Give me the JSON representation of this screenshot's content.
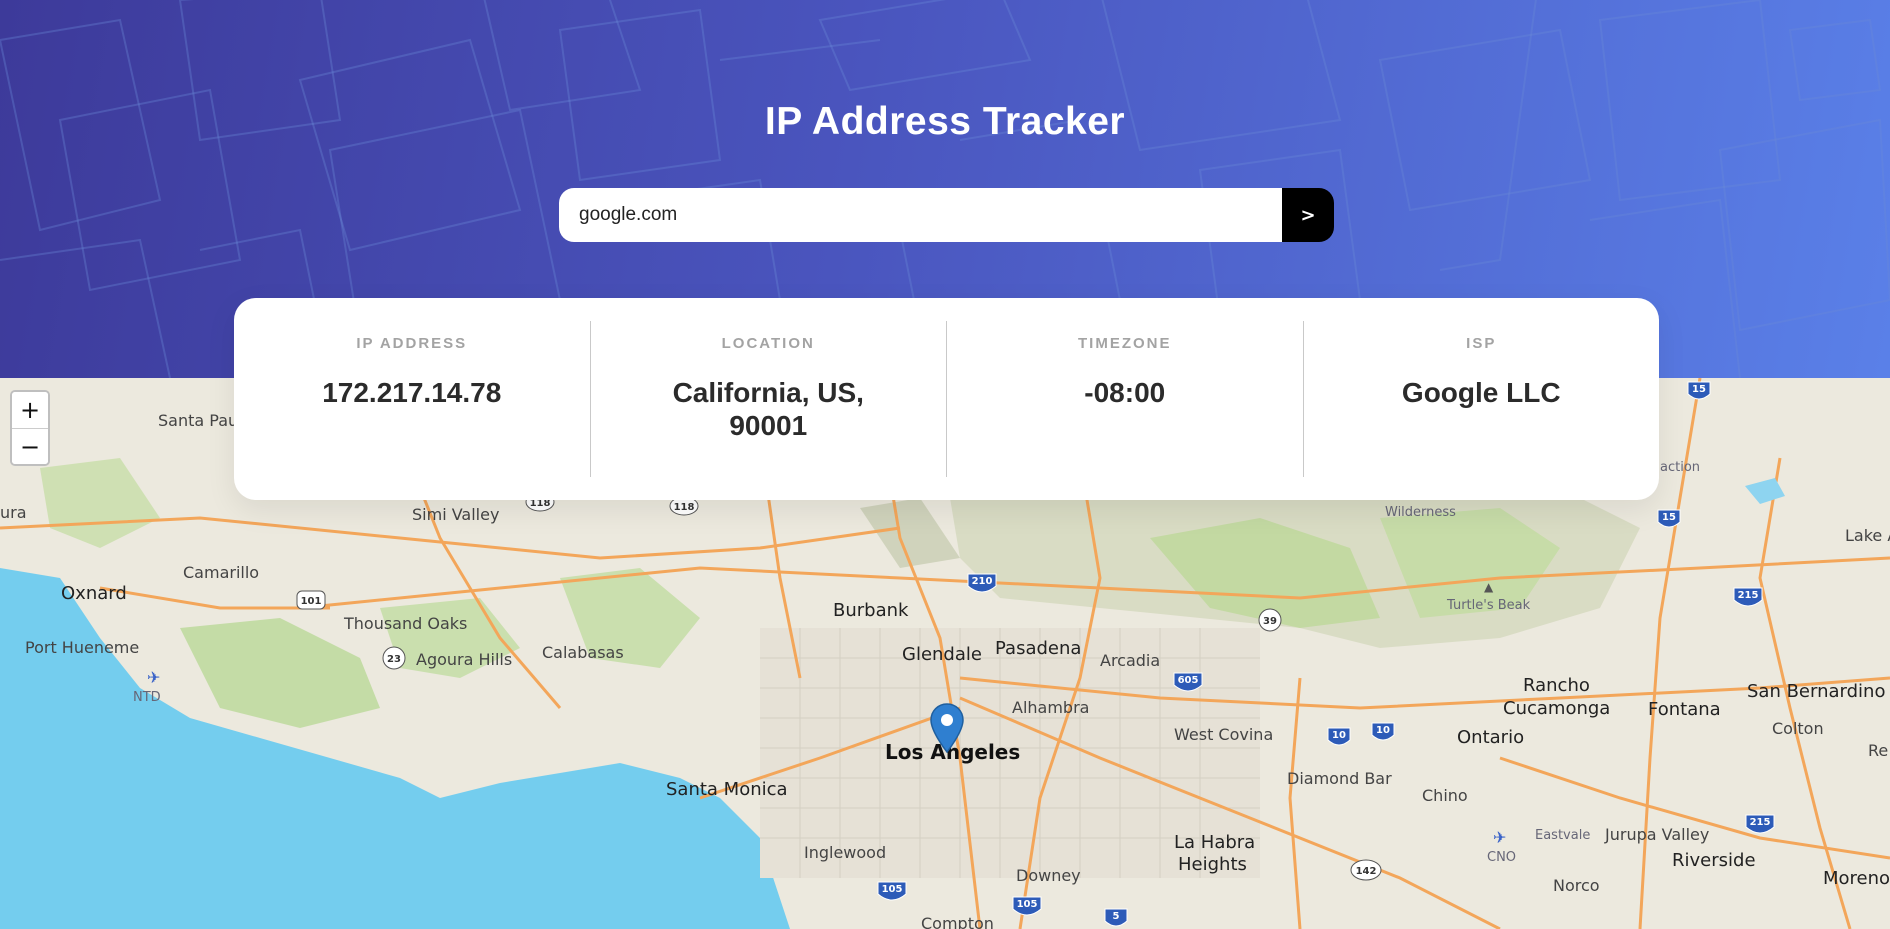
{
  "header": {
    "title": "IP Address Tracker",
    "search": {
      "value": "google.com",
      "button_label": ">"
    }
  },
  "info": {
    "ip_label": "IP ADDRESS",
    "ip_value": "172.217.14.78",
    "location_label": "LOCATION",
    "location_value": "California, US, 90001",
    "timezone_label": "TIMEZONE",
    "timezone_value": "-08:00",
    "isp_label": "ISP",
    "isp_value": "Google LLC"
  },
  "map": {
    "zoom_in_label": "+",
    "zoom_out_label": "−",
    "labels": {
      "santa_paula": "Santa Paula",
      "simi_valley": "Simi Valley",
      "camarillo": "Camarillo",
      "oxnard": "Oxnard",
      "thousand_oaks": "Thousand Oaks",
      "port_hueneme": "Port Hueneme",
      "ntd": "NTD",
      "agoura_hills": "Agoura Hills",
      "calabasas": "Calabasas",
      "burbank": "Burbank",
      "glendale": "Glendale",
      "pasadena": "Pasadena",
      "arcadia": "Arcadia",
      "alhambra": "Alhambra",
      "los_angeles": "Los Angeles",
      "santa_monica": "Santa Monica",
      "west_covina": "West Covina",
      "diamond_bar": "Diamond Bar",
      "chino": "Chino",
      "ontario": "Ontario",
      "rancho": "Rancho",
      "cucamonga": "Cucamonga",
      "fontana": "Fontana",
      "san_bernardino": "San Bernardino",
      "colton": "Colton",
      "wilderness": "Wilderness",
      "turtles_beak": "Turtle's Beak",
      "lake_a": "Lake A",
      "inglewood": "Inglewood",
      "downey": "Downey",
      "la_habra": "La Habra",
      "heights": "Heights",
      "eastvale": "Eastvale",
      "jurupa_valley": "Jurupa Valley",
      "riverside": "Riverside",
      "norco": "Norco",
      "moreno_v": "Moreno V",
      "cno": "CNO",
      "compton": "Compton",
      "ura": "ura",
      "action": "action",
      "re": "Re"
    },
    "shields": {
      "s118a": "118",
      "s118b": "118",
      "s210": "210",
      "s101": "101",
      "s23": "23",
      "s39": "39",
      "s605": "605",
      "s10a": "10",
      "s10b": "10",
      "s15a": "15",
      "s15b": "15",
      "s215a": "215",
      "s215b": "215",
      "s105a": "105",
      "s105b": "105",
      "s142": "142",
      "s5": "5"
    }
  }
}
